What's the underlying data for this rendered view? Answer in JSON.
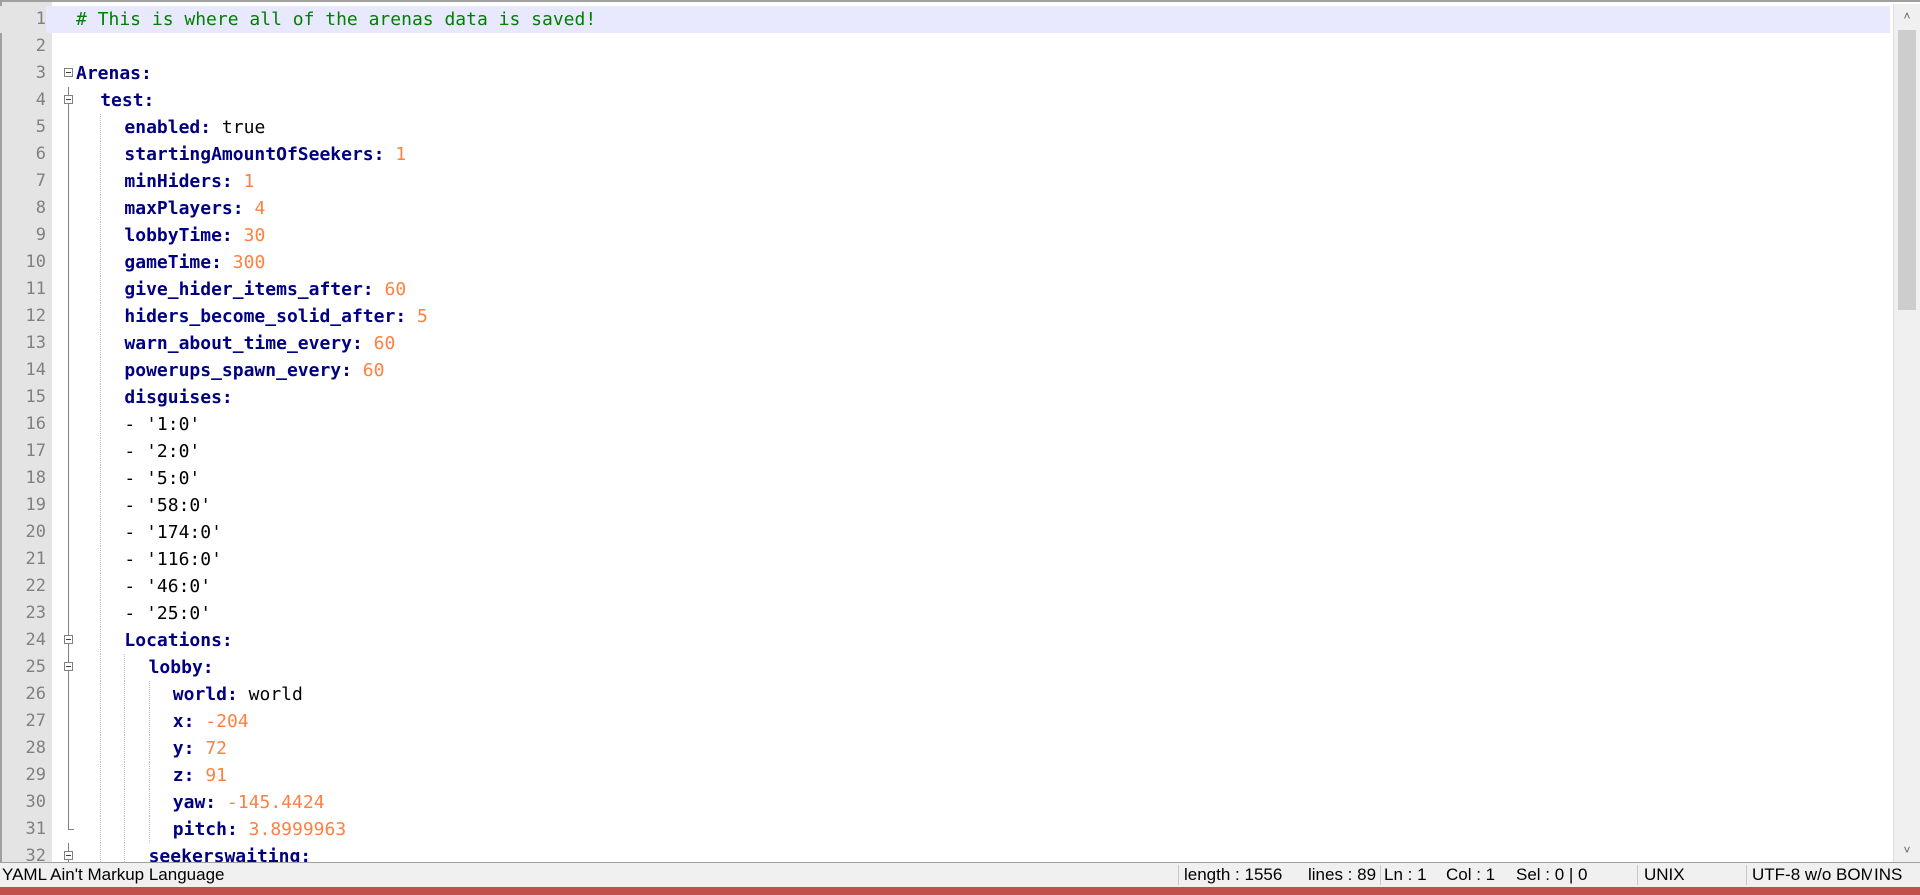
{
  "editor": {
    "lines": [
      {
        "n": "1",
        "tokens": [
          {
            "t": "comment",
            "v": "# This is where all of the arenas data is saved!"
          }
        ],
        "indent": 0
      },
      {
        "n": "2",
        "tokens": [],
        "indent": 0
      },
      {
        "n": "3",
        "tokens": [
          {
            "t": "key",
            "v": "Arenas:"
          }
        ],
        "indent": 0,
        "fold": "open"
      },
      {
        "n": "4",
        "tokens": [
          {
            "t": "key",
            "v": "test:"
          }
        ],
        "indent": 1,
        "fold": "open"
      },
      {
        "n": "5",
        "tokens": [
          {
            "t": "key",
            "v": "enabled:"
          },
          {
            "t": "str",
            "v": " true"
          }
        ],
        "indent": 2
      },
      {
        "n": "6",
        "tokens": [
          {
            "t": "key",
            "v": "startingAmountOfSeekers:"
          },
          {
            "t": "num",
            "v": " 1"
          }
        ],
        "indent": 2
      },
      {
        "n": "7",
        "tokens": [
          {
            "t": "key",
            "v": "minHiders:"
          },
          {
            "t": "num",
            "v": " 1"
          }
        ],
        "indent": 2
      },
      {
        "n": "8",
        "tokens": [
          {
            "t": "key",
            "v": "maxPlayers:"
          },
          {
            "t": "num",
            "v": " 4"
          }
        ],
        "indent": 2
      },
      {
        "n": "9",
        "tokens": [
          {
            "t": "key",
            "v": "lobbyTime:"
          },
          {
            "t": "num",
            "v": " 30"
          }
        ],
        "indent": 2
      },
      {
        "n": "10",
        "tokens": [
          {
            "t": "key",
            "v": "gameTime:"
          },
          {
            "t": "num",
            "v": " 300"
          }
        ],
        "indent": 2
      },
      {
        "n": "11",
        "tokens": [
          {
            "t": "key",
            "v": "give_hider_items_after:"
          },
          {
            "t": "num",
            "v": " 60"
          }
        ],
        "indent": 2
      },
      {
        "n": "12",
        "tokens": [
          {
            "t": "key",
            "v": "hiders_become_solid_after:"
          },
          {
            "t": "num",
            "v": " 5"
          }
        ],
        "indent": 2
      },
      {
        "n": "13",
        "tokens": [
          {
            "t": "key",
            "v": "warn_about_time_every:"
          },
          {
            "t": "num",
            "v": " 60"
          }
        ],
        "indent": 2
      },
      {
        "n": "14",
        "tokens": [
          {
            "t": "key",
            "v": "powerups_spawn_every:"
          },
          {
            "t": "num",
            "v": " 60"
          }
        ],
        "indent": 2
      },
      {
        "n": "15",
        "tokens": [
          {
            "t": "key",
            "v": "disguises:"
          }
        ],
        "indent": 2
      },
      {
        "n": "16",
        "tokens": [
          {
            "t": "dash",
            "v": "- "
          },
          {
            "t": "str",
            "v": "'1:0'"
          }
        ],
        "indent": 2
      },
      {
        "n": "17",
        "tokens": [
          {
            "t": "dash",
            "v": "- "
          },
          {
            "t": "str",
            "v": "'2:0'"
          }
        ],
        "indent": 2
      },
      {
        "n": "18",
        "tokens": [
          {
            "t": "dash",
            "v": "- "
          },
          {
            "t": "str",
            "v": "'5:0'"
          }
        ],
        "indent": 2
      },
      {
        "n": "19",
        "tokens": [
          {
            "t": "dash",
            "v": "- "
          },
          {
            "t": "str",
            "v": "'58:0'"
          }
        ],
        "indent": 2
      },
      {
        "n": "20",
        "tokens": [
          {
            "t": "dash",
            "v": "- "
          },
          {
            "t": "str",
            "v": "'174:0'"
          }
        ],
        "indent": 2
      },
      {
        "n": "21",
        "tokens": [
          {
            "t": "dash",
            "v": "- "
          },
          {
            "t": "str",
            "v": "'116:0'"
          }
        ],
        "indent": 2
      },
      {
        "n": "22",
        "tokens": [
          {
            "t": "dash",
            "v": "- "
          },
          {
            "t": "str",
            "v": "'46:0'"
          }
        ],
        "indent": 2
      },
      {
        "n": "23",
        "tokens": [
          {
            "t": "dash",
            "v": "- "
          },
          {
            "t": "str",
            "v": "'25:0'"
          }
        ],
        "indent": 2
      },
      {
        "n": "24",
        "tokens": [
          {
            "t": "key",
            "v": "Locations:"
          }
        ],
        "indent": 2,
        "fold": "open"
      },
      {
        "n": "25",
        "tokens": [
          {
            "t": "key",
            "v": "lobby:"
          }
        ],
        "indent": 3,
        "fold": "open"
      },
      {
        "n": "26",
        "tokens": [
          {
            "t": "key",
            "v": "world:"
          },
          {
            "t": "str",
            "v": " world"
          }
        ],
        "indent": 4
      },
      {
        "n": "27",
        "tokens": [
          {
            "t": "key",
            "v": "x:"
          },
          {
            "t": "num",
            "v": " -204"
          }
        ],
        "indent": 4
      },
      {
        "n": "28",
        "tokens": [
          {
            "t": "key",
            "v": "y:"
          },
          {
            "t": "num",
            "v": " 72"
          }
        ],
        "indent": 4
      },
      {
        "n": "29",
        "tokens": [
          {
            "t": "key",
            "v": "z:"
          },
          {
            "t": "num",
            "v": " 91"
          }
        ],
        "indent": 4
      },
      {
        "n": "30",
        "tokens": [
          {
            "t": "key",
            "v": "yaw:"
          },
          {
            "t": "num",
            "v": " -145.4424"
          }
        ],
        "indent": 4
      },
      {
        "n": "31",
        "tokens": [
          {
            "t": "key",
            "v": "pitch:"
          },
          {
            "t": "num",
            "v": " 3.8999963"
          }
        ],
        "indent": 4,
        "fold": "end"
      },
      {
        "n": "32",
        "tokens": [
          {
            "t": "key",
            "v": "seekerswaiting:"
          }
        ],
        "indent": 3,
        "fold": "open"
      }
    ]
  },
  "statusbar": {
    "language": "YAML Ain't Markup Language",
    "length": "length : 1556",
    "lines": "lines : 89",
    "ln": "Ln : 1",
    "col": "Col : 1",
    "sel": "Sel : 0 | 0",
    "eol": "UNIX",
    "encoding": "UTF-8 w/o BOM",
    "mode": "INS"
  },
  "colors": {
    "comment": "#008000",
    "key": "#000080",
    "number": "#ff8040",
    "current_line": "#e8e8ff"
  }
}
